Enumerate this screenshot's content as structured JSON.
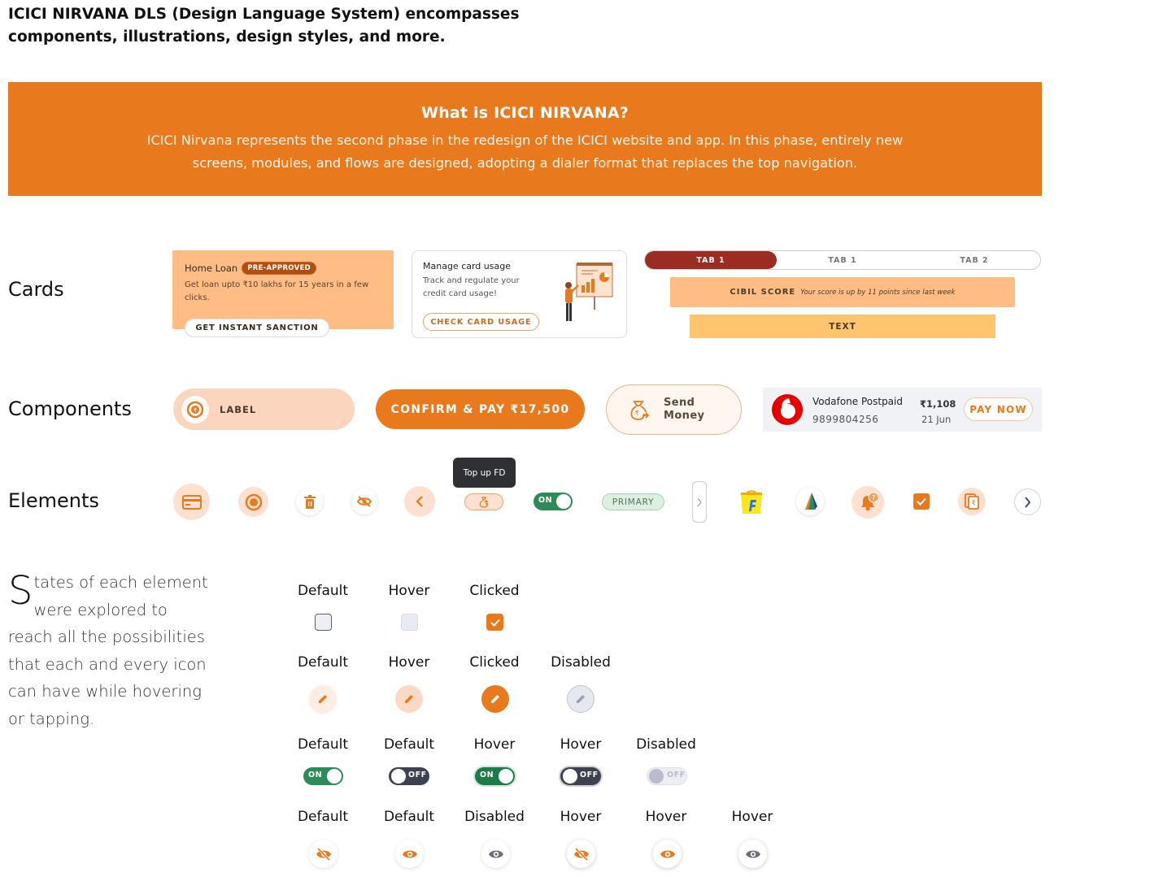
{
  "intro": {
    "line1": "ICICI NIRVANA DLS (Design Language System) encompasses",
    "line2": "components, illustrations, design styles, and more."
  },
  "banner": {
    "title": "What is ICICI NIRVANA?",
    "text": "ICICI Nirvana represents the second phase in the redesign of the ICICI website and app. In this phase, entirely new screens, modules, and flows are designed, adopting a dialer format that replaces the top navigation.",
    "bg_color": "#e8791c"
  },
  "sections": {
    "cards": "Cards",
    "components": "Components",
    "elements": "Elements"
  },
  "cards": {
    "home_loan": {
      "title": "Home Loan",
      "badge": "PRE-APPROVED",
      "desc": "Get loan upto ₹10 lakhs for 15 years in a few clicks.",
      "button": "GET INSTANT SANCTION"
    },
    "card_usage": {
      "title": "Manage card usage",
      "desc": "Track and regulate your credit card usage!",
      "button": "CHECK CARD USAGE",
      "illustration": "presenter-illustration"
    },
    "tabs": [
      "TAB 1",
      "TAB 1",
      "TAB 2"
    ],
    "cibil": {
      "key": "CIBIL SCORE",
      "value": "Your score is up by 11 points since last week"
    },
    "text_bar": "TEXT"
  },
  "components": {
    "label_chip": "LABEL",
    "confirm_button": "CONFIRM & PAY ₹17,500",
    "send_money_line1": "Send",
    "send_money_line2": "Money",
    "bill": {
      "name": "Vodafone Postpaid",
      "number": "9899804256",
      "amount": "₹1,108",
      "due": "21 Jun",
      "button": "PAY NOW"
    }
  },
  "elements": {
    "tooltip": "Top up FD",
    "toggle_on": "ON",
    "pill": "PRIMARY",
    "notification_count": "7",
    "icons": [
      "card-icon",
      "rupee-coin-icon",
      "trash-icon",
      "eye-off-icon",
      "chevron-left-icon",
      "top-up-fd-icon",
      "toggle",
      "primary-pill",
      "side-tab-handle",
      "flipkart-logo",
      "bank-logo",
      "bell-icon",
      "checkbox-icon",
      "rupee-document-icon",
      "chevron-right-icon"
    ]
  },
  "states": {
    "description_initial": "S",
    "description_rest": "tates of each element were explored to reach all the possibilities that each and every icon can have while hovering or tapping.",
    "row1": [
      "Default",
      "Hover",
      "Clicked"
    ],
    "row2": [
      "Default",
      "Hover",
      "Clicked",
      "Disabled"
    ],
    "row3": [
      "Default",
      "Default",
      "Hover",
      "Hover",
      "Disabled"
    ],
    "row3_toggle_labels": [
      "ON",
      "OFF",
      "ON",
      "OFF",
      "OFF"
    ],
    "row4": [
      "Default",
      "Default",
      "Disabled",
      "Hover",
      "Hover",
      "Hover"
    ]
  },
  "colors": {
    "accent": "#e8791c",
    "success": "#2e8b57",
    "dark": "#3d4150",
    "maroon": "#9a2c24"
  }
}
